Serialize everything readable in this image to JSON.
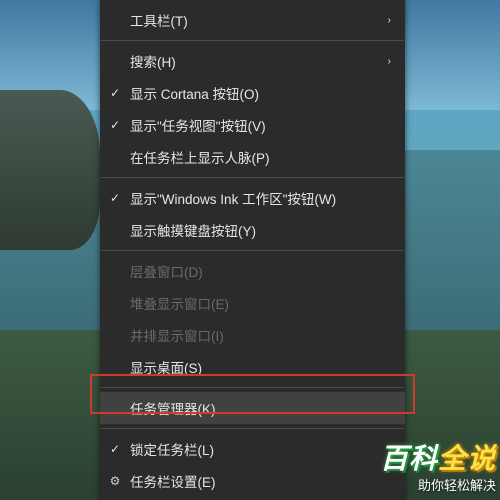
{
  "menu": {
    "items": [
      {
        "label": "工具栏(T)",
        "submenu": true
      },
      {
        "sep": true
      },
      {
        "label": "搜索(H)",
        "submenu": true
      },
      {
        "label": "显示 Cortana 按钮(O)",
        "checked": true
      },
      {
        "label": "显示\"任务视图\"按钮(V)",
        "checked": true
      },
      {
        "label": "在任务栏上显示人脉(P)"
      },
      {
        "sep": true
      },
      {
        "label": "显示\"Windows Ink 工作区\"按钮(W)",
        "checked": true
      },
      {
        "label": "显示触摸键盘按钮(Y)"
      },
      {
        "sep": true
      },
      {
        "label": "层叠窗口(D)",
        "disabled": true
      },
      {
        "label": "堆叠显示窗口(E)",
        "disabled": true
      },
      {
        "label": "并排显示窗口(I)",
        "disabled": true
      },
      {
        "label": "显示桌面(S)"
      },
      {
        "sep": true
      },
      {
        "label": "任务管理器(K)",
        "hover": true
      },
      {
        "sep": true
      },
      {
        "label": "锁定任务栏(L)",
        "checked": true
      },
      {
        "label": "任务栏设置(E)",
        "icon": "gear"
      }
    ]
  },
  "watermark": {
    "main_a": "百科",
    "main_b": "全说",
    "sub": "助你轻松解决"
  },
  "chevron": "›"
}
